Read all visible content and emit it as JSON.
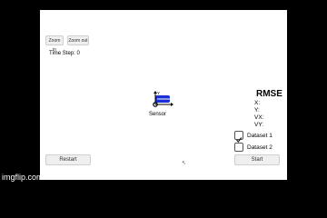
{
  "toolbar": {
    "zoom_in_label": "Zoom in",
    "zoom_out_label": "Zoom out"
  },
  "status": {
    "time_step_label": "Time Step: 0"
  },
  "scene": {
    "sensor_label": "Sensor",
    "car_color": "#1a2fd6",
    "axis_y_label": "Y"
  },
  "rmse": {
    "title": "RMSE",
    "rows": [
      "X:",
      "Y:",
      "VX:",
      "VY:"
    ]
  },
  "datasets": [
    {
      "label": "Dataset 1",
      "checked": true
    },
    {
      "label": "Dataset 2",
      "checked": false
    }
  ],
  "controls": {
    "restart_label": "Restart",
    "start_label": "Start"
  },
  "watermark": "imgflip.com"
}
